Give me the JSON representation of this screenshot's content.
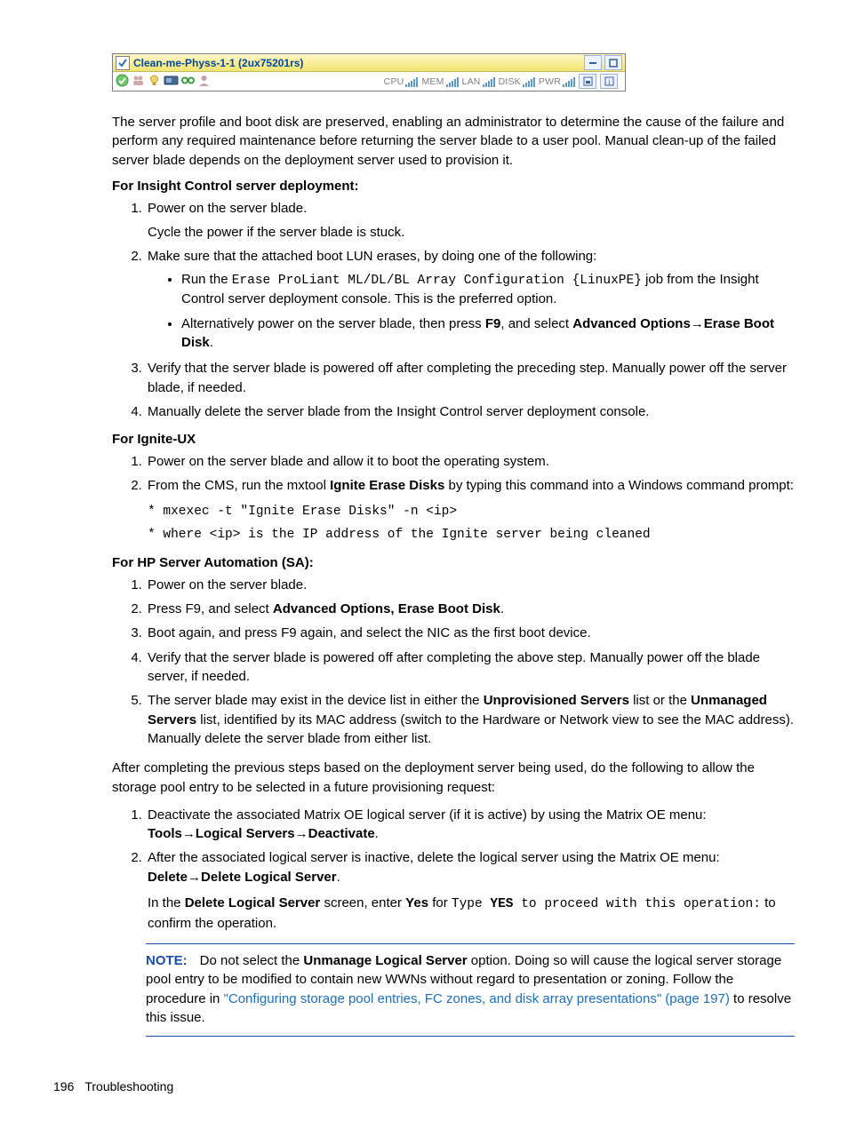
{
  "tile": {
    "title": "Clean-me-Physs-1-1 (2ux75201rs)",
    "meters": [
      "CPU",
      "MEM",
      "LAN",
      "DISK",
      "PWR"
    ]
  },
  "para1": "The server profile and boot disk are preserved, enabling an administrator to determine the cause of the failure and perform any required maintenance before returning the server blade to a user pool. Manual clean-up of the failed server blade depends on the deployment server used to provision it.",
  "h_insight": "For Insight Control server deployment:",
  "insight": {
    "i1a": "Power on the server blade.",
    "i1b": "Cycle the power if the server blade is stuck.",
    "i2": "Make sure that the attached boot LUN erases, by doing one of the following:",
    "b1a": "Run the ",
    "b1b": "Erase ProLiant ML/DL/BL Array Configuration {LinuxPE}",
    "b1c": " job from the Insight Control server deployment console. This is the preferred option.",
    "b2a": "Alternatively power on the server blade, then press ",
    "b2b": "F9",
    "b2c": ", and select ",
    "b2d": "Advanced Options",
    "b2e": "→",
    "b2f": "Erase Boot Disk",
    "b2g": ".",
    "i3": "Verify that the server blade is powered off after completing the preceding step. Manually power off the server blade, if needed.",
    "i4": "Manually delete the server blade from the Insight Control server deployment console."
  },
  "h_ignite": "For Ignite-UX",
  "ignite": {
    "i1": "Power on the server blade and allow it to boot the operating system.",
    "i2a": "From the CMS, run the mxtool ",
    "i2b": "Ignite Erase Disks",
    "i2c": " by typing this command into a Windows command prompt:",
    "c1": "* mxexec -t \"Ignite Erase Disks\" -n <ip>",
    "c2": "* where <ip> is the IP address of the Ignite server being cleaned"
  },
  "h_sa": "For HP Server Automation (SA):",
  "sa": {
    "i1": "Power on the server blade.",
    "i2a": "Press F9, and select ",
    "i2b": "Advanced Options, Erase Boot Disk",
    "i2c": ".",
    "i3": "Boot again, and press F9 again, and select the NIC as the first boot device.",
    "i4": "Verify that the server blade is powered off after completing the above step. Manually power off the blade server, if needed.",
    "i5a": "The server blade may exist in the device list in either the ",
    "i5b": "Unprovisioned Servers",
    "i5c": " list or the ",
    "i5d": "Unmanaged Servers",
    "i5e": " list, identified by its MAC address (switch to the Hardware or Network view to see the MAC address). Manually delete the server blade from either list."
  },
  "para2": "After completing the previous steps based on the deployment server being used, do the following to allow the storage pool entry to be selected in a future provisioning request:",
  "final": {
    "i1a": "Deactivate the associated Matrix OE logical server (if it is active) by using the Matrix OE menu: ",
    "i1b": "Tools",
    "arr": "→",
    "i1c": "Logical Servers",
    "i1d": "Deactivate",
    "i1e": ".",
    "i2a": "After the associated logical server is inactive, delete the logical server using the Matrix OE menu: ",
    "i2b": "Delete",
    "i2c": "Delete Logical Server",
    "i2d": ".",
    "i2sub_a": "In the ",
    "i2sub_b": "Delete Logical Server",
    "i2sub_c": " screen, enter ",
    "i2sub_d": "Yes",
    "i2sub_e": " for ",
    "i2sub_f": "Type ",
    "i2sub_g": "YES",
    "i2sub_h": " to proceed with this operation:",
    "i2sub_i": " to confirm the operation."
  },
  "note": {
    "lbl": "NOTE:",
    "a": "Do not select the ",
    "b": "Unmanage Logical Server",
    "c": " option. Doing so will cause the logical server storage pool entry to be modified to contain new WWNs without regard to presentation or zoning. Follow the procedure in ",
    "link": "\"Configuring storage pool entries, FC zones, and disk array presentations\" (page 197)",
    "d": " to resolve this issue."
  },
  "footer": {
    "page": "196",
    "section": "Troubleshooting"
  }
}
